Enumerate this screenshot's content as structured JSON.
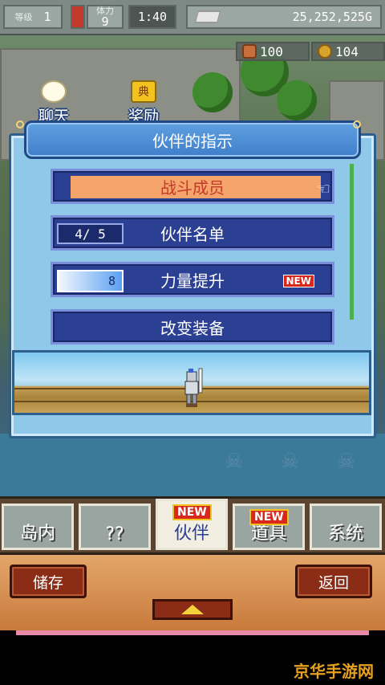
{
  "status_bar": {
    "level_label": "等级",
    "level_value": "1",
    "stamina_label": "体力",
    "stamina_value": "9",
    "time": "1:40",
    "gold": "25,252,525G",
    "coin_red_value": "100",
    "coin_gold_value": "104"
  },
  "bubbles": {
    "chat_label": "聊天",
    "reward_label": "奖励",
    "reward_icon_text": "典"
  },
  "dialog": {
    "title": "伙伴的指示",
    "items": [
      {
        "label": "战斗成员"
      },
      {
        "label": "伙伴名单",
        "count": "4/ 5"
      },
      {
        "label": "力量提升",
        "power": "8",
        "badge": "NEW"
      },
      {
        "label": "改变装备"
      }
    ]
  },
  "tabs": [
    {
      "label": "岛内"
    },
    {
      "label": "??"
    },
    {
      "label": "伙伴",
      "badge": "NEW"
    },
    {
      "label": "道具",
      "badge": "NEW"
    },
    {
      "label": "系统"
    }
  ],
  "controls": {
    "save_label": "储存",
    "back_label": "返回"
  },
  "watermark": "京华手游网",
  "colors": {
    "menu_bg": "#2b3f93",
    "selected_highlight": "#f5a46c",
    "panel_bg": "#8fc8e8",
    "new_badge": "#d8281e",
    "control_bar": "#c87a3c"
  }
}
